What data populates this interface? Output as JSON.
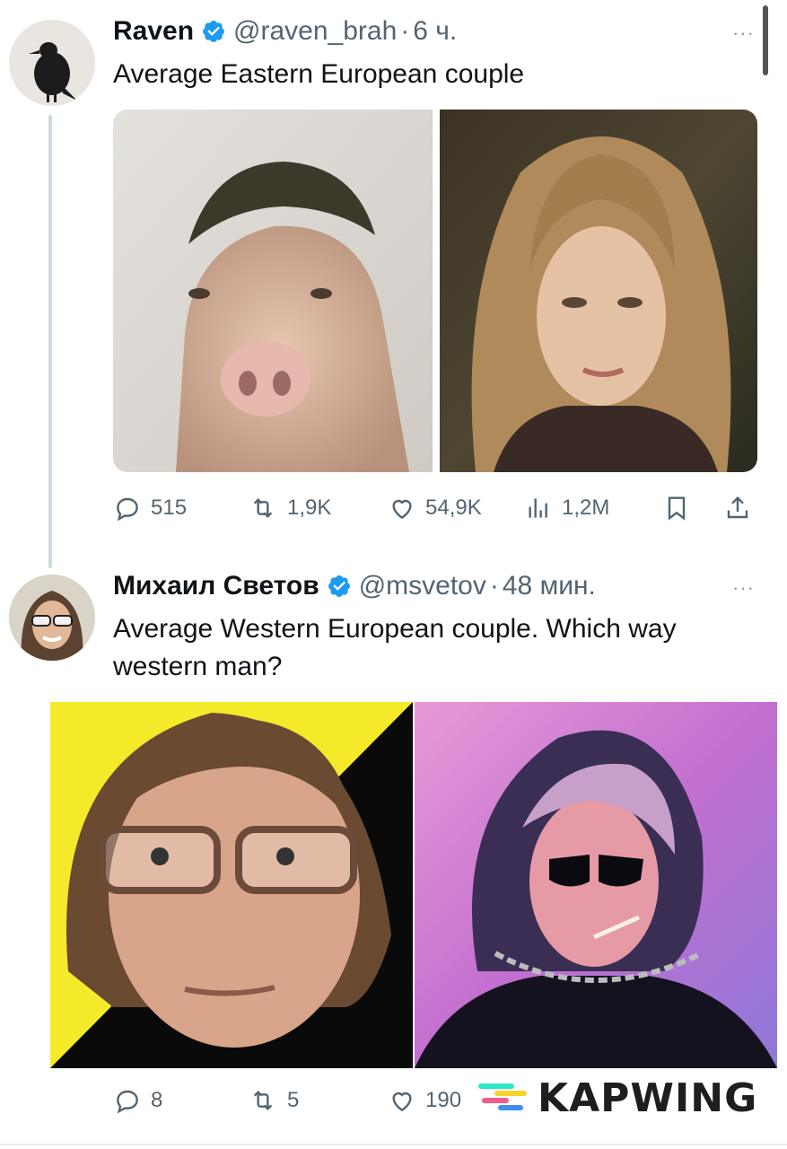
{
  "tweet1": {
    "display_name": "Raven",
    "handle": "@raven_brah",
    "separator": "·",
    "time": "6 ч.",
    "text": "Average Eastern European couple",
    "replies": "515",
    "retweets": "1,9K",
    "likes": "54,9K",
    "views": "1,2M"
  },
  "tweet2": {
    "display_name": "Михаил Светов",
    "handle": "@msvetov",
    "separator": "·",
    "time": "48 мин.",
    "text_line1": "Average Western European couple. Which way",
    "text_line2": "western man?",
    "replies": "8",
    "retweets": "5",
    "likes": "190"
  },
  "more_label": "···",
  "watermark": {
    "brand": "KAPWING",
    "colors": [
      "#2ee6c8",
      "#f7d62a",
      "#f25c8a",
      "#3f8cf2"
    ]
  },
  "colors": {
    "text_primary": "#0f1419",
    "text_secondary": "#536471",
    "verified_blue": "#1d9bf0",
    "thread_line": "#cfd9de"
  },
  "icons": [
    "reply-icon",
    "retweet-icon",
    "like-icon",
    "views-icon",
    "bookmark-icon",
    "share-icon",
    "verified-badge-icon",
    "more-icon"
  ]
}
